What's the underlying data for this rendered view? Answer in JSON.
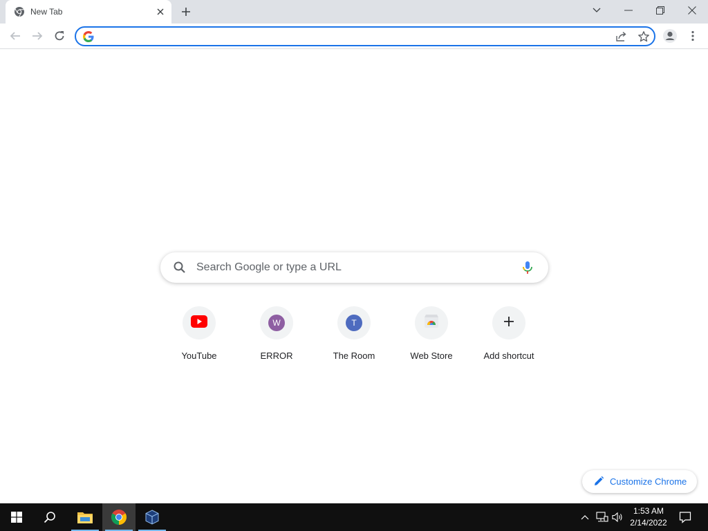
{
  "browser": {
    "tab_title": "New Tab",
    "omnibox_value": "",
    "omnibox_placeholder": ""
  },
  "ntp": {
    "search_placeholder": "Search Google or type a URL",
    "shortcuts": [
      {
        "label": "YouTube",
        "icon": "youtube-icon"
      },
      {
        "label": "ERROR",
        "letter": "W",
        "color": "#8e5ea2"
      },
      {
        "label": "The Room",
        "letter": "T",
        "color": "#4e6bbf"
      },
      {
        "label": "Web Store",
        "icon": "web-store-icon"
      },
      {
        "label": "Add shortcut",
        "icon": "plus-icon"
      }
    ],
    "customize_label": "Customize Chrome"
  },
  "taskbar": {
    "time": "1:53 AM",
    "date": "2/14/2022"
  },
  "colors": {
    "accent": "#1a73e8",
    "tabstrip": "#dee1e6",
    "taskbar": "#101010"
  }
}
